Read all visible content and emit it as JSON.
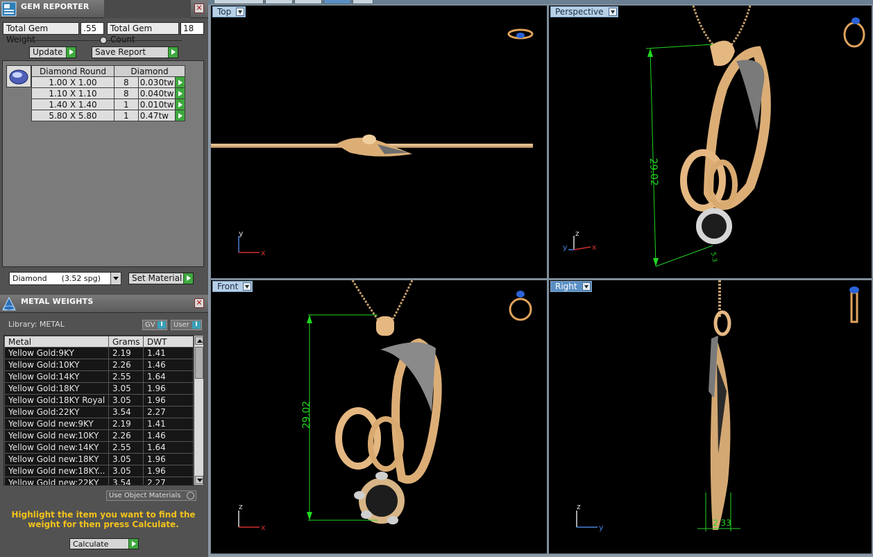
{
  "gem_reporter": {
    "title": "GEM REPORTER",
    "close": "✕",
    "total_gem_weight_label": "Total Gem Weight",
    "total_gem_weight_value": ".55",
    "total_gem_count_label": "Total Gem Count",
    "total_gem_count_value": "18",
    "update_label": "Update",
    "save_report_label": "Save Report",
    "table": {
      "headers": [
        "Diamond Round",
        "Diamond"
      ],
      "rows": [
        {
          "size": "1.00 X 1.00",
          "count": "8",
          "weight": "0.030tw"
        },
        {
          "size": "1.10 X 1.10",
          "count": "8",
          "weight": "0.040tw"
        },
        {
          "size": "1.40 X 1.40",
          "count": "1",
          "weight": "0.010tw"
        },
        {
          "size": "5.80 X 5.80",
          "count": "1",
          "weight": "0.47tw"
        }
      ]
    },
    "material_select": "Diamond      (3.52 spg)",
    "set_material_label": "Set Material"
  },
  "metal_weights": {
    "title": "METAL WEIGHTS",
    "close": "✕",
    "library_label": "Library: METAL",
    "gv_label": "GV",
    "user_label": "User",
    "toggle_mark": "I",
    "columns": [
      "Metal",
      "Grams",
      "DWT"
    ],
    "rows": [
      {
        "metal": "Yellow Gold:9KY",
        "grams": "2.19",
        "dwt": "1.41"
      },
      {
        "metal": "Yellow Gold:10KY",
        "grams": "2.26",
        "dwt": "1.46"
      },
      {
        "metal": "Yellow Gold:14KY",
        "grams": "2.55",
        "dwt": "1.64"
      },
      {
        "metal": "Yellow Gold:18KY",
        "grams": "3.05",
        "dwt": "1.96"
      },
      {
        "metal": "Yellow Gold:18KY Royal",
        "grams": "3.05",
        "dwt": "1.96"
      },
      {
        "metal": "Yellow Gold:22KY",
        "grams": "3.54",
        "dwt": "2.27"
      },
      {
        "metal": "Yellow Gold new:9KY",
        "grams": "2.19",
        "dwt": "1.41"
      },
      {
        "metal": "Yellow Gold new:10KY",
        "grams": "2.26",
        "dwt": "1.46"
      },
      {
        "metal": "Yellow Gold new:14KY",
        "grams": "2.55",
        "dwt": "1.64"
      },
      {
        "metal": "Yellow Gold new:18KY",
        "grams": "3.05",
        "dwt": "1.96"
      },
      {
        "metal": "Yellow Gold new:18KY...",
        "grams": "3.05",
        "dwt": "1.96"
      },
      {
        "metal": "Yellow Gold new:22KY",
        "grams": "3.54",
        "dwt": "2.27"
      }
    ],
    "use_object_materials": "Use Object Materials",
    "hint": "Highlight the item you want to find the weight for then press Calculate.",
    "calculate_label": "Calculate"
  },
  "viewports": {
    "top": {
      "label": "Top",
      "axes": {
        "a": "y",
        "b": "x"
      }
    },
    "perspective": {
      "label": "Perspective",
      "axes": {
        "a": "z",
        "b": "y",
        "c": "x"
      },
      "dimension": "29.02",
      "dimension_small": "5.3"
    },
    "front": {
      "label": "Front",
      "axes": {
        "a": "z",
        "b": "x"
      },
      "dimension": "29.02"
    },
    "right": {
      "label": "Right",
      "axes": {
        "a": "z",
        "b": "y"
      },
      "dimension": "2.33"
    }
  },
  "colors": {
    "gold": "#e2b57e",
    "dimension": "#22d622",
    "axis_x": "#d03030",
    "axis_y": "#4a7fd8",
    "panel": "#525252"
  }
}
